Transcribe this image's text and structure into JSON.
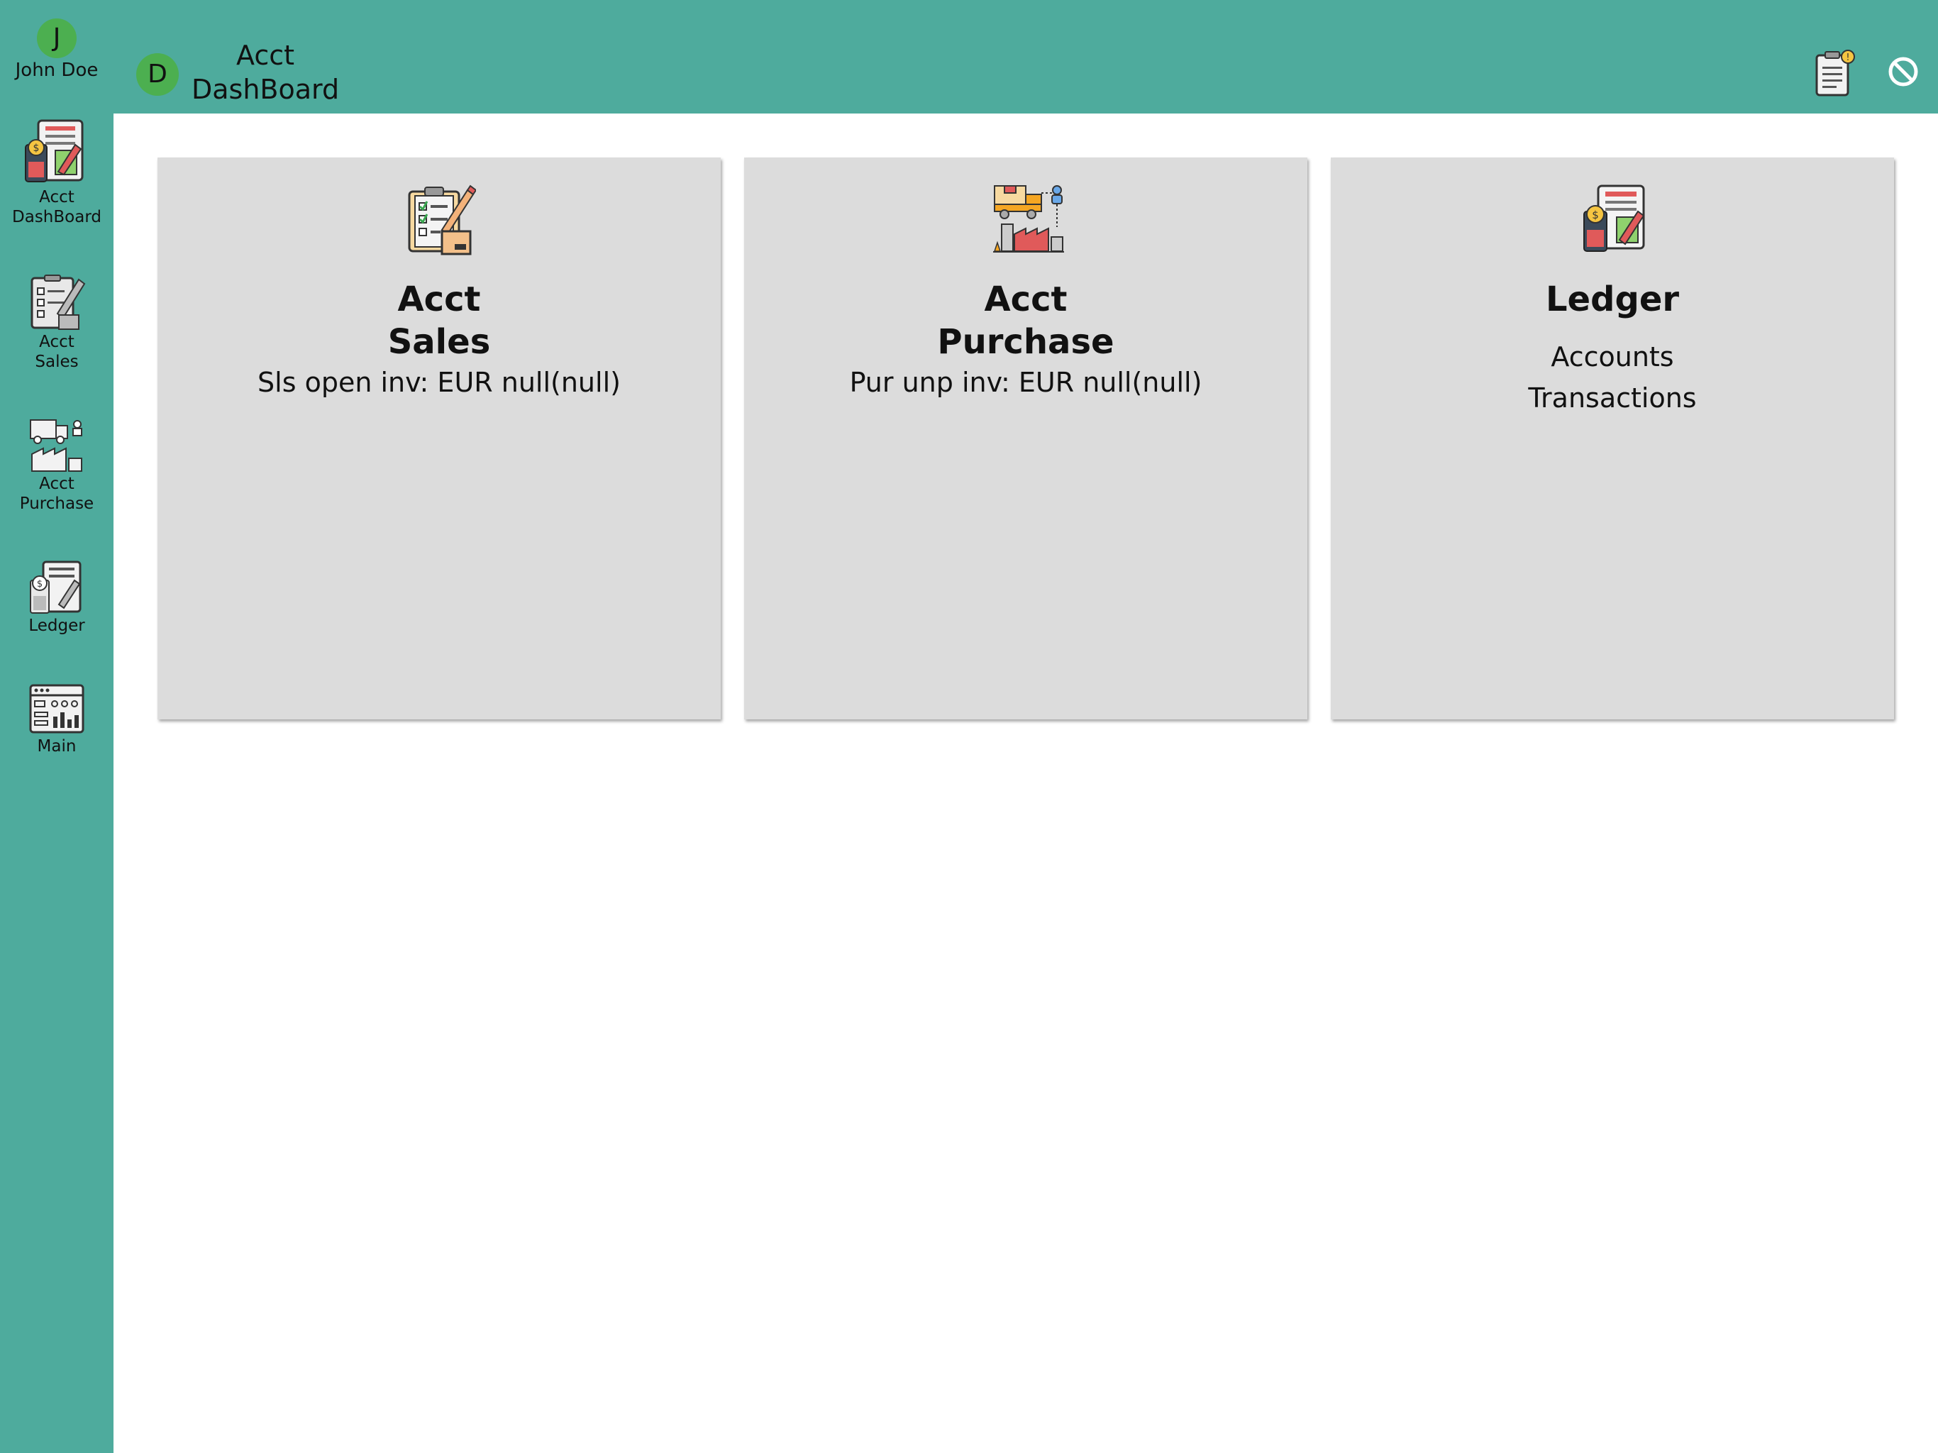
{
  "user": {
    "initial": "J",
    "name": "John Doe"
  },
  "header": {
    "avatar_initial": "D",
    "title": "Acct\nDashBoard"
  },
  "sidebar": {
    "items": [
      {
        "label": "Acct\nDashBoard",
        "icon": "ledger-icon"
      },
      {
        "label": "Acct\nSales",
        "icon": "sales-checklist-icon"
      },
      {
        "label": "Acct\nPurchase",
        "icon": "purchase-delivery-icon"
      },
      {
        "label": "Ledger",
        "icon": "ledger-icon"
      },
      {
        "label": "Main",
        "icon": "dashboard-icon"
      }
    ]
  },
  "cards": [
    {
      "title": "Acct\nSales",
      "subtitle": "Sls open inv: EUR null(null)",
      "icon": "sales-checklist-icon"
    },
    {
      "title": "Acct\nPurchase",
      "subtitle": "Pur unp inv: EUR null(null)",
      "icon": "purchase-delivery-icon"
    },
    {
      "title": "Ledger",
      "subtitle": "Accounts\nTransactions",
      "icon": "ledger-icon"
    }
  ],
  "colors": {
    "bar": "#4eab9d",
    "avatar": "#4caf50",
    "card": "#dcdcdc"
  }
}
